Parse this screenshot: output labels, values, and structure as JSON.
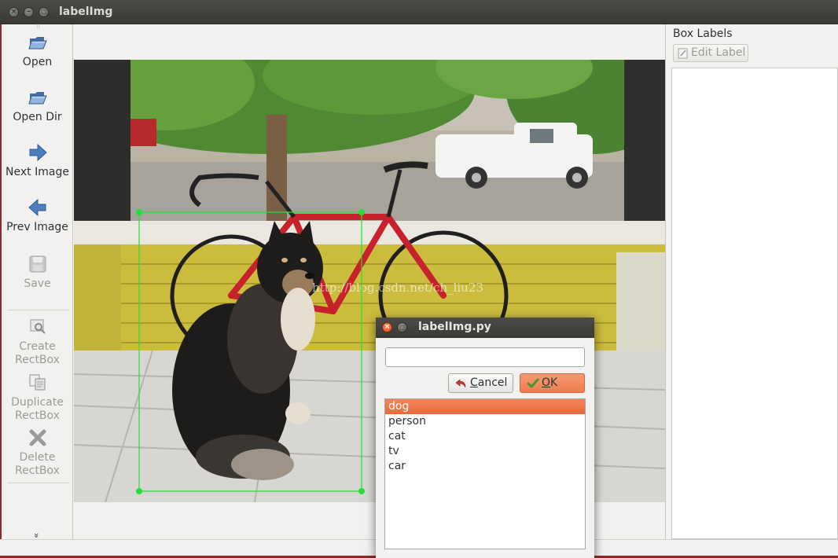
{
  "window": {
    "title": "labelImg",
    "close_glyph": "×",
    "minimize_glyph": "–",
    "maximize_glyph": "▢"
  },
  "toolbar": {
    "items": [
      {
        "label": "Open",
        "icon": "folder-open-icon",
        "enabled": true
      },
      {
        "label": "Open Dir",
        "icon": "folder-open-icon",
        "enabled": true
      },
      {
        "label": "Next Image",
        "icon": "arrow-right-icon",
        "enabled": true
      },
      {
        "label": "Prev Image",
        "icon": "arrow-left-icon",
        "enabled": true
      },
      {
        "label": "Save",
        "icon": "save-icon",
        "enabled": false
      },
      {
        "label": "Create\nRectBox",
        "icon": "create-rect-icon",
        "enabled": false
      },
      {
        "label": "Duplicate\nRectBox",
        "icon": "duplicate-icon",
        "enabled": false
      },
      {
        "label": "Delete\nRectBox",
        "icon": "delete-icon",
        "enabled": false
      }
    ],
    "more_glyph": "»"
  },
  "canvas": {
    "watermark": "http://blog.csdn.net/ch_liu23",
    "bounding_box": {
      "color": "#22e03a"
    }
  },
  "dock": {
    "title": "Box Labels",
    "edit_label_button": "Edit Label"
  },
  "dialog": {
    "title": "labelImg.py",
    "input_value": "",
    "cancel_label_prefix": "",
    "cancel_mnemonic": "C",
    "cancel_label_rest": "ancel",
    "ok_mnemonic": "O",
    "ok_label_rest": "K",
    "labels": [
      "dog",
      "person",
      "cat",
      "tv",
      "car"
    ],
    "selected_index": 0
  },
  "colors": {
    "accent": "#ef7c4f",
    "titlebar": "#3c3b37",
    "window_border": "#8d2a2a"
  }
}
